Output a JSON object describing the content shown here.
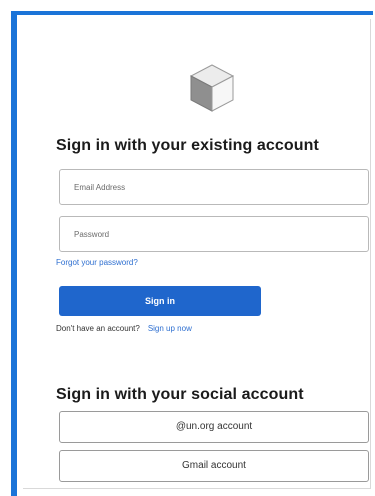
{
  "logo": {
    "icon": "cube-icon"
  },
  "existing_section": {
    "heading": "Sign in with your existing account",
    "email_placeholder": "Email Address",
    "password_placeholder": "Password",
    "forgot_link": "Forgot your password?",
    "signin_button": "Sign in",
    "no_account_text": "Don't have an account?",
    "signup_link": "Sign up now"
  },
  "social_section": {
    "heading": "Sign in with your social account",
    "buttons": [
      {
        "label": "@un.org account"
      },
      {
        "label": "Gmail account"
      }
    ]
  },
  "colors": {
    "accent": "#1f66cc",
    "frame_border": "#1b74d8",
    "link": "#2e6fd0"
  }
}
